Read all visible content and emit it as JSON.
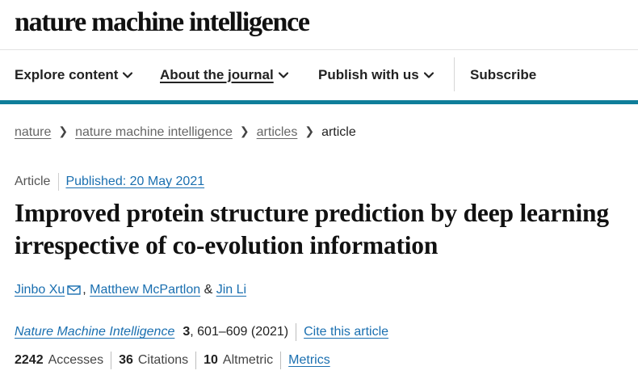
{
  "brand": "nature machine intelligence",
  "nav": {
    "explore": "Explore content",
    "about": "About the journal",
    "publish": "Publish with us",
    "subscribe": "Subscribe"
  },
  "breadcrumb": [
    "nature",
    "nature machine intelligence",
    "articles",
    "article"
  ],
  "article": {
    "type": "Article",
    "published": "Published: 20 May 2021",
    "title": "Improved protein structure prediction by deep learning irrespective of co-evolution information",
    "authors": [
      "Jinbo Xu",
      "Matthew McPartlon",
      "Jin Li"
    ],
    "author_sep_1": ",",
    "author_sep_2": "&"
  },
  "citation": {
    "journal": "Nature Machine Intelligence",
    "volume": "3",
    "pages_year": ", 601–609 (2021)",
    "cite_link": "Cite this article"
  },
  "metrics": {
    "accesses_value": "2242",
    "accesses_label": "Accesses",
    "citations_value": "36",
    "citations_label": "Citations",
    "altmetric_value": "10",
    "altmetric_label": "Altmetric",
    "metrics_link": "Metrics"
  },
  "icons": {
    "chevron": "chevron-down-icon",
    "crumb_separator": "chevron-right-icon",
    "email": "email-icon"
  },
  "colors": {
    "accent_bar": "#0f7e9a",
    "link": "#1a6fb0"
  }
}
